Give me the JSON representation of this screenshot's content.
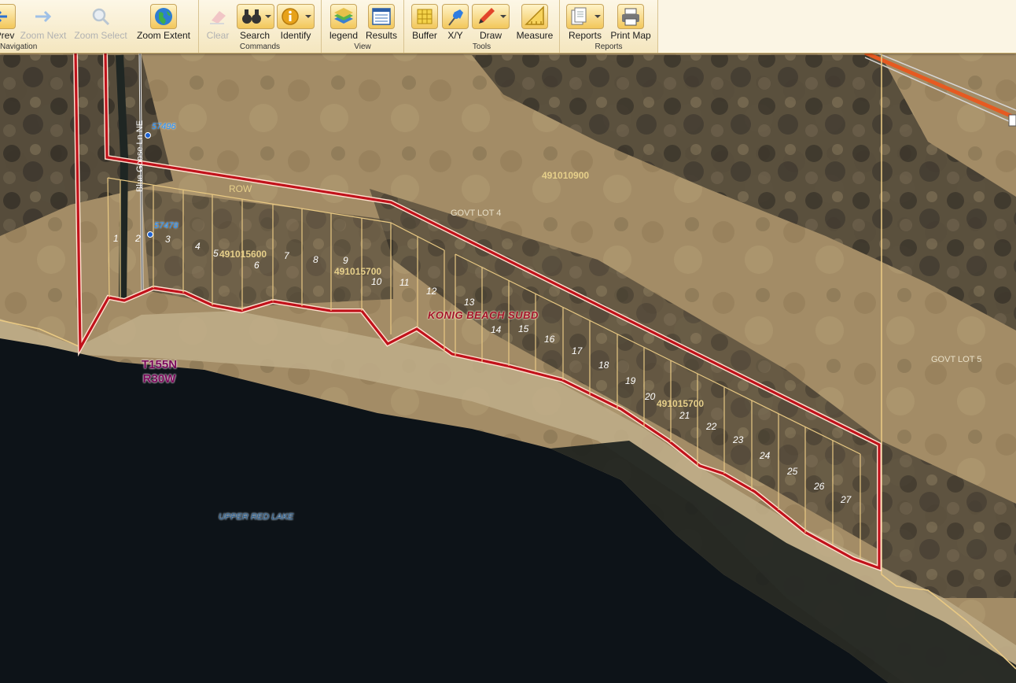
{
  "toolbar": {
    "navigation": {
      "title": "Navigation",
      "prev": "Prev",
      "zoom_next": "Zoom Next",
      "zoom_select": "Zoom Select",
      "zoom_extent": "Zoom Extent"
    },
    "commands": {
      "title": "Commands",
      "clear": "Clear",
      "search": "Search",
      "identify": "Identify"
    },
    "view": {
      "title": "View",
      "legend": "legend",
      "results": "Results"
    },
    "tools": {
      "title": "Tools",
      "buffer": "Buffer",
      "xy": "X/Y",
      "draw": "Draw",
      "measure": "Measure"
    },
    "reports": {
      "title": "Reports",
      "reports": "Reports",
      "print_map": "Print Map"
    }
  },
  "map": {
    "road_name": "Blue Goose Ln NE",
    "addresses": [
      "57496",
      "57478"
    ],
    "row_label": "ROW",
    "govt_lot_4": "GOVT LOT 4",
    "govt_lot_5": "GOVT LOT 5",
    "parcels": {
      "p1": "491010900",
      "p2": "491015600",
      "p3": "491015700",
      "p4": "491015700"
    },
    "subdivision": "KONIG BEACH SUBD",
    "township": "T155N",
    "range": "R30W",
    "lake": "UPPER RED LAKE",
    "lots": [
      "1",
      "2",
      "3",
      "4",
      "5",
      "6",
      "7",
      "8",
      "9",
      "10",
      "11",
      "12",
      "13",
      "14",
      "15",
      "16",
      "17",
      "18",
      "19",
      "20",
      "21",
      "22",
      "23",
      "24",
      "25",
      "26",
      "27"
    ]
  },
  "colors": {
    "toolbar_bg": "#f7ecd0",
    "boundary_red": "#c0121b",
    "lot_line": "#e9c983",
    "lake_water": "#0d1318"
  }
}
